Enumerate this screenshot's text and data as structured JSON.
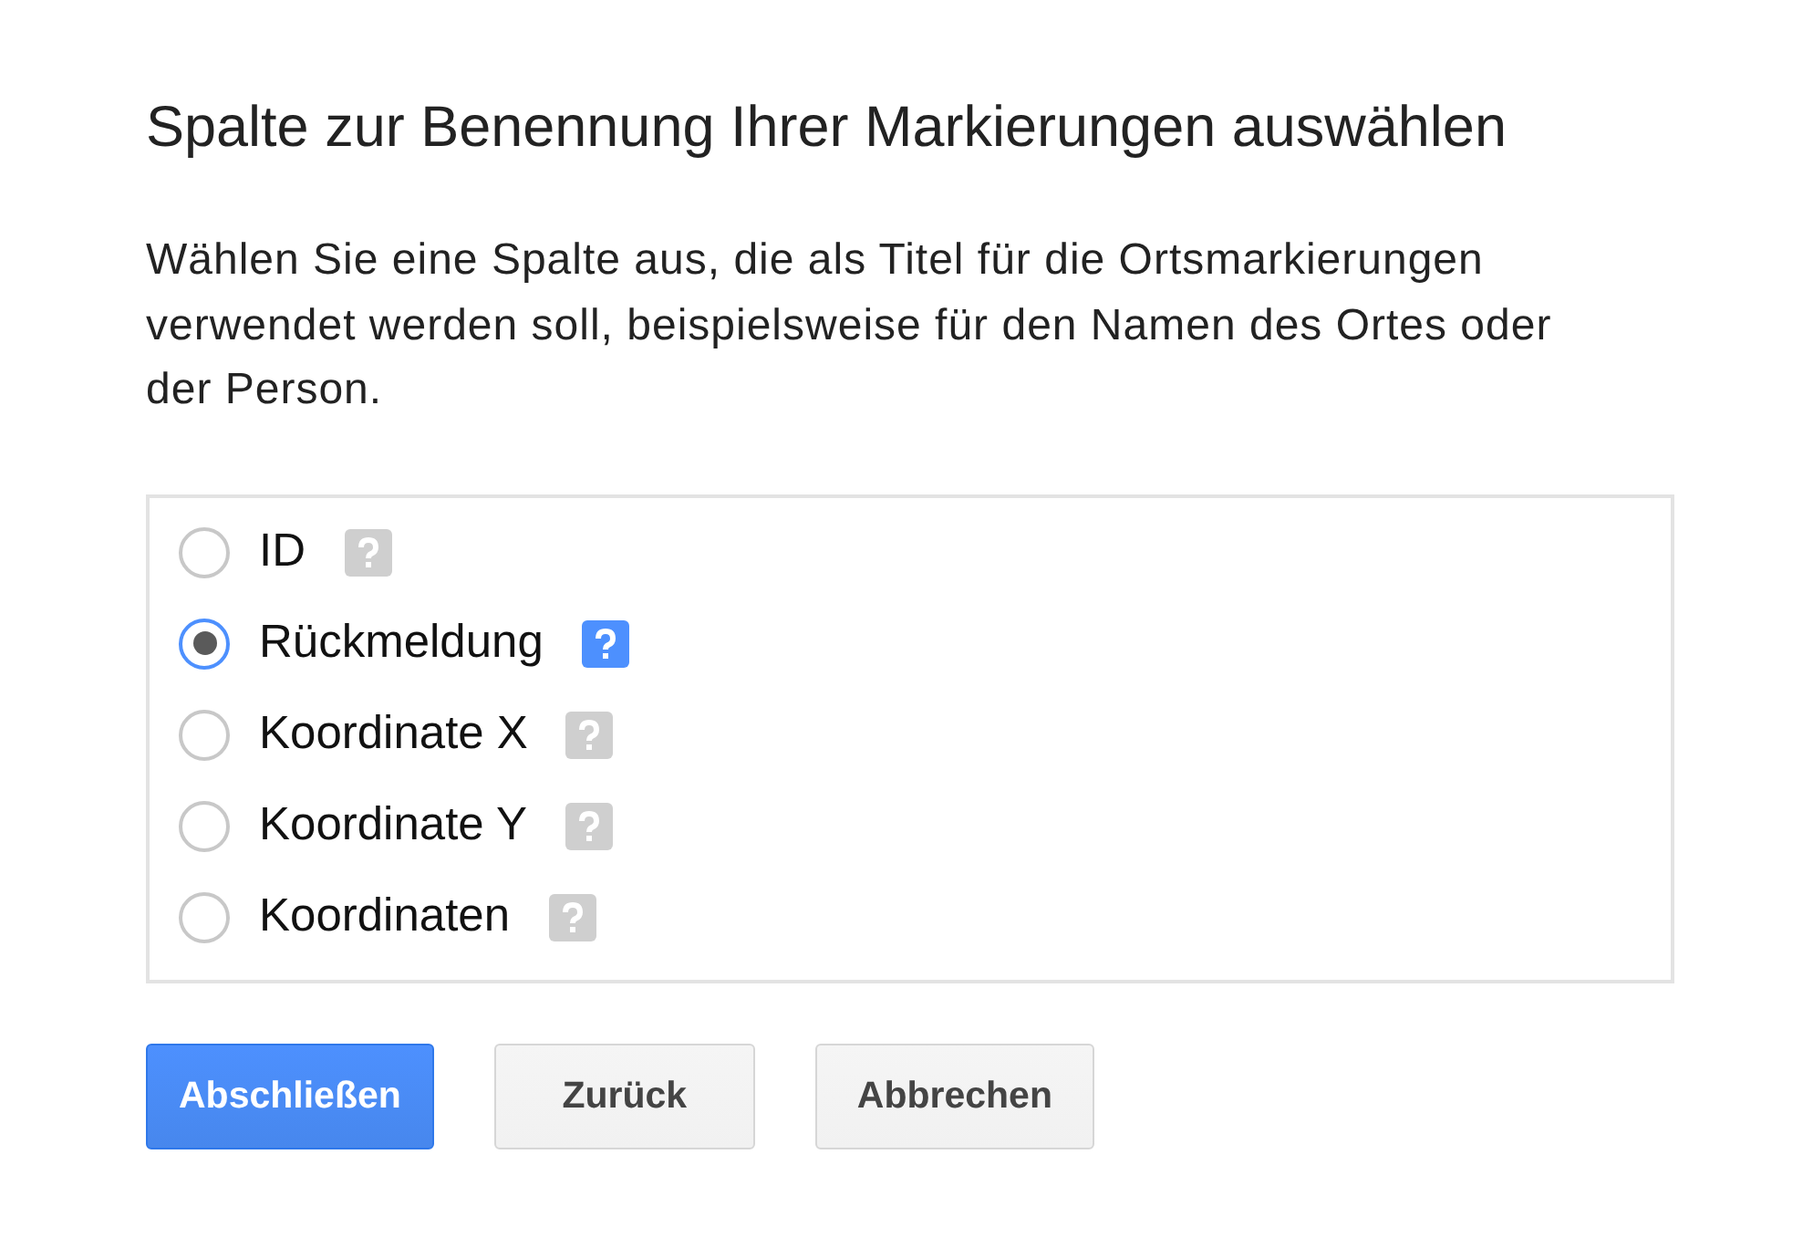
{
  "dialog": {
    "title": "Spalte zur Benennung Ihrer Markierungen auswählen",
    "description": "Wählen Sie eine Spalte aus, die als Titel für die Ortsmarkierungen verwendet werden soll, beispielsweise für den Namen des Ortes oder der Person."
  },
  "options": [
    {
      "label": "ID",
      "selected": false
    },
    {
      "label": "Rückmeldung",
      "selected": true
    },
    {
      "label": "Koordinate X",
      "selected": false
    },
    {
      "label": "Koordinate Y",
      "selected": false
    },
    {
      "label": "Koordinaten",
      "selected": false
    }
  ],
  "buttons": [
    {
      "label": "Abschließen",
      "kind": "primary"
    },
    {
      "label": "Zurück",
      "kind": "secondary"
    },
    {
      "label": "Abbrechen",
      "kind": "secondary"
    }
  ]
}
